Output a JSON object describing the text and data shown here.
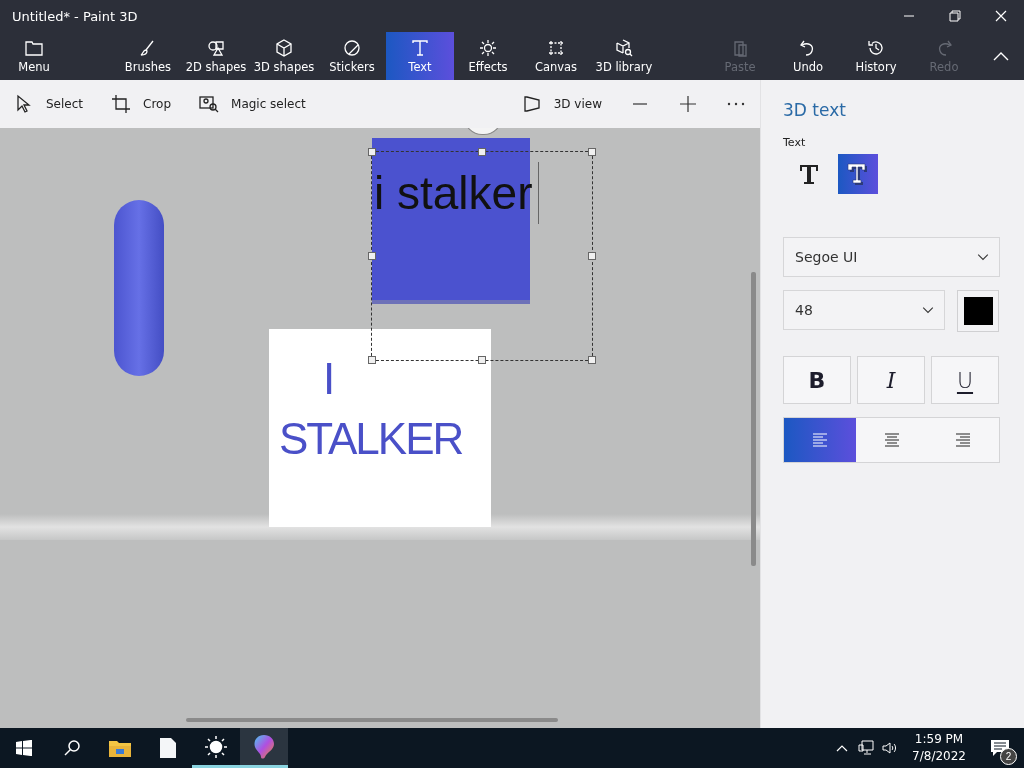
{
  "window": {
    "title": "Untitled* - Paint 3D"
  },
  "ribbon": {
    "menu": {
      "label": "Menu"
    },
    "tools": [
      {
        "label": "Brushes",
        "selected": false
      },
      {
        "label": "2D shapes",
        "selected": false
      },
      {
        "label": "3D shapes",
        "selected": false
      },
      {
        "label": "Stickers",
        "selected": false
      },
      {
        "label": "Text",
        "selected": true
      },
      {
        "label": "Effects",
        "selected": false
      },
      {
        "label": "Canvas",
        "selected": false
      },
      {
        "label": "3D library",
        "selected": false
      }
    ],
    "actions": [
      {
        "label": "Paste",
        "disabled": true
      },
      {
        "label": "Undo",
        "disabled": false
      },
      {
        "label": "History",
        "disabled": false
      },
      {
        "label": "Redo",
        "disabled": true
      }
    ]
  },
  "toolbar": {
    "left": [
      {
        "label": "Select"
      },
      {
        "label": "Crop"
      },
      {
        "label": "Magic select"
      }
    ],
    "view": {
      "label": "3D view"
    }
  },
  "canvas": {
    "text_object": "i stalker",
    "sticker_lines": [
      "I",
      "STALKER"
    ]
  },
  "panel": {
    "title": "3D text",
    "section_label": "Text",
    "text_types": [
      {
        "kind": "flat",
        "selected": false
      },
      {
        "kind": "extruded",
        "selected": true
      }
    ],
    "font": "Segoe UI",
    "size": "48",
    "styles": [
      {
        "label": "B",
        "kind": "bold",
        "selected": false
      },
      {
        "label": "I",
        "kind": "italic",
        "selected": false
      },
      {
        "label": "U",
        "kind": "underline",
        "selected": false
      }
    ],
    "alignment": [
      {
        "kind": "left",
        "selected": true
      },
      {
        "kind": "center",
        "selected": false
      },
      {
        "kind": "right",
        "selected": false
      }
    ]
  },
  "taskbar": {
    "apps": [
      {
        "kind": "start",
        "running": false,
        "selected": false
      },
      {
        "kind": "search",
        "running": false,
        "selected": false
      },
      {
        "kind": "folder",
        "running": false,
        "selected": false
      },
      {
        "kind": "file",
        "running": false,
        "selected": false
      },
      {
        "kind": "sun",
        "running": true,
        "selected": false
      },
      {
        "kind": "paint",
        "running": true,
        "selected": true
      }
    ],
    "time": "1:59 PM",
    "date": "7/8/2022",
    "notifications": "2"
  }
}
